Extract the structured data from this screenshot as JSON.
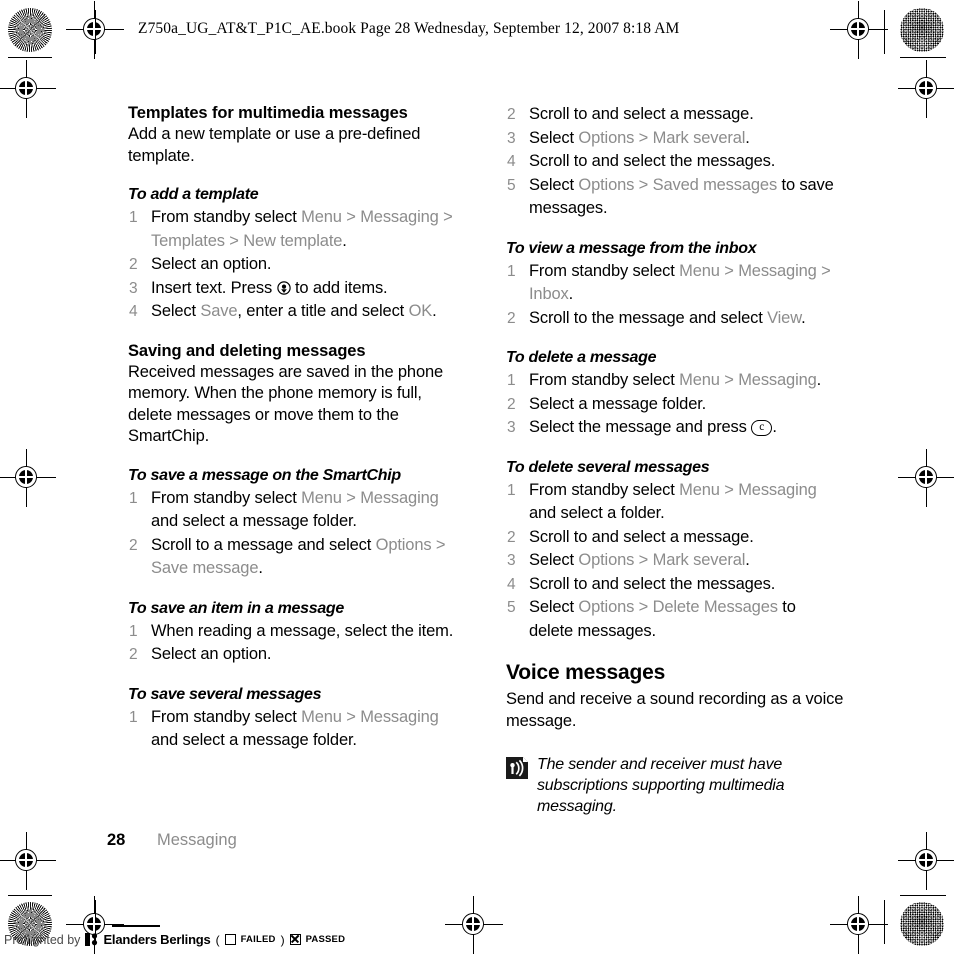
{
  "book_header": "Z750a_UG_AT&T_P1C_AE.book  Page 28  Wednesday, September 12, 2007  8:18 AM",
  "left_column": {
    "section_title": "Templates for multimedia messages",
    "section_intro": "Add a new template or use a pre-defined template.",
    "task1": {
      "title": "To add a template",
      "steps": [
        {
          "parts": [
            {
              "t": "From standby select ",
              "s": "plain"
            },
            {
              "t": "Menu",
              "s": "ui"
            },
            {
              "t": " > ",
              "s": "sep"
            },
            {
              "t": "Messaging",
              "s": "ui"
            },
            {
              "t": " > ",
              "s": "sep"
            },
            {
              "t": "Templates",
              "s": "ui"
            },
            {
              "t": " > ",
              "s": "sep"
            },
            {
              "t": "New template",
              "s": "ui"
            },
            {
              "t": ".",
              "s": "plain"
            }
          ]
        },
        {
          "parts": [
            {
              "t": "Select an option.",
              "s": "plain"
            }
          ]
        },
        {
          "parts": [
            {
              "t": "Insert text. Press ",
              "s": "plain"
            },
            {
              "t": "",
              "s": "navkey"
            },
            {
              "t": " to add items.",
              "s": "plain"
            }
          ]
        },
        {
          "parts": [
            {
              "t": "Select ",
              "s": "plain"
            },
            {
              "t": "Save",
              "s": "ui"
            },
            {
              "t": ", enter a title and select ",
              "s": "plain"
            },
            {
              "t": "OK",
              "s": "ui"
            },
            {
              "t": ".",
              "s": "plain"
            }
          ]
        }
      ]
    },
    "section2_title": "Saving and deleting messages",
    "section2_intro": "Received messages are saved in the phone memory. When the phone memory is full, delete messages or move them to the SmartChip.",
    "task2": {
      "title": "To save a message on the SmartChip",
      "steps": [
        {
          "parts": [
            {
              "t": "From standby select ",
              "s": "plain"
            },
            {
              "t": "Menu",
              "s": "ui"
            },
            {
              "t": " > ",
              "s": "sep"
            },
            {
              "t": "Messaging",
              "s": "ui"
            },
            {
              "t": " and select a message folder.",
              "s": "plain"
            }
          ]
        },
        {
          "parts": [
            {
              "t": "Scroll to a message and select ",
              "s": "plain"
            },
            {
              "t": "Options",
              "s": "ui"
            },
            {
              "t": " > ",
              "s": "sep"
            },
            {
              "t": "Save message",
              "s": "ui"
            },
            {
              "t": ".",
              "s": "plain"
            }
          ]
        }
      ]
    },
    "task3": {
      "title": "To save an item in a message",
      "steps": [
        {
          "parts": [
            {
              "t": "When reading a message, select the item.",
              "s": "plain"
            }
          ]
        },
        {
          "parts": [
            {
              "t": "Select an option.",
              "s": "plain"
            }
          ]
        }
      ]
    },
    "task4": {
      "title": "To save several messages",
      "steps": [
        {
          "parts": [
            {
              "t": "From standby select ",
              "s": "plain"
            },
            {
              "t": "Menu",
              "s": "ui"
            },
            {
              "t": " > ",
              "s": "sep"
            },
            {
              "t": "Messaging",
              "s": "ui"
            },
            {
              "t": " and select a message folder.",
              "s": "plain"
            }
          ]
        }
      ]
    }
  },
  "right_column": {
    "task4_cont": {
      "steps": [
        {
          "n": 2,
          "parts": [
            {
              "t": "Scroll to and select a message.",
              "s": "plain"
            }
          ]
        },
        {
          "n": 3,
          "parts": [
            {
              "t": "Select ",
              "s": "plain"
            },
            {
              "t": "Options",
              "s": "ui"
            },
            {
              "t": " > ",
              "s": "sep"
            },
            {
              "t": "Mark several",
              "s": "ui"
            },
            {
              "t": ".",
              "s": "plain"
            }
          ]
        },
        {
          "n": 4,
          "parts": [
            {
              "t": "Scroll to and select the messages.",
              "s": "plain"
            }
          ]
        },
        {
          "n": 5,
          "parts": [
            {
              "t": "Select ",
              "s": "plain"
            },
            {
              "t": "Options",
              "s": "ui"
            },
            {
              "t": " > ",
              "s": "sep"
            },
            {
              "t": "Saved messages",
              "s": "ui"
            },
            {
              "t": " to save messages.",
              "s": "plain"
            }
          ]
        }
      ]
    },
    "task5": {
      "title": "To view a message from the inbox",
      "steps": [
        {
          "n": 1,
          "parts": [
            {
              "t": "From standby select ",
              "s": "plain"
            },
            {
              "t": "Menu",
              "s": "ui"
            },
            {
              "t": " > ",
              "s": "sep"
            },
            {
              "t": "Messaging",
              "s": "ui"
            },
            {
              "t": " > ",
              "s": "sep"
            },
            {
              "t": "Inbox",
              "s": "ui"
            },
            {
              "t": ".",
              "s": "plain"
            }
          ]
        },
        {
          "n": 2,
          "parts": [
            {
              "t": "Scroll to the message and select ",
              "s": "plain"
            },
            {
              "t": "View",
              "s": "ui"
            },
            {
              "t": ".",
              "s": "plain"
            }
          ]
        }
      ]
    },
    "task6": {
      "title": "To delete a message",
      "steps": [
        {
          "n": 1,
          "parts": [
            {
              "t": "From standby select ",
              "s": "plain"
            },
            {
              "t": "Menu",
              "s": "ui"
            },
            {
              "t": " > ",
              "s": "sep"
            },
            {
              "t": "Messaging",
              "s": "ui"
            },
            {
              "t": ".",
              "s": "plain"
            }
          ]
        },
        {
          "n": 2,
          "parts": [
            {
              "t": "Select a message folder.",
              "s": "plain"
            }
          ]
        },
        {
          "n": 3,
          "parts": [
            {
              "t": "Select the message and press ",
              "s": "plain"
            },
            {
              "t": "c",
              "s": "keycap"
            },
            {
              "t": ".",
              "s": "plain"
            }
          ]
        }
      ]
    },
    "task7": {
      "title": "To delete several messages",
      "steps": [
        {
          "n": 1,
          "parts": [
            {
              "t": "From standby select ",
              "s": "plain"
            },
            {
              "t": "Menu",
              "s": "ui"
            },
            {
              "t": " > ",
              "s": "sep"
            },
            {
              "t": "Messaging",
              "s": "ui"
            },
            {
              "t": " and select a folder.",
              "s": "plain"
            }
          ]
        },
        {
          "n": 2,
          "parts": [
            {
              "t": "Scroll to and select a message.",
              "s": "plain"
            }
          ]
        },
        {
          "n": 3,
          "parts": [
            {
              "t": "Select ",
              "s": "plain"
            },
            {
              "t": "Options",
              "s": "ui"
            },
            {
              "t": " > ",
              "s": "sep"
            },
            {
              "t": "Mark several",
              "s": "ui"
            },
            {
              "t": ".",
              "s": "plain"
            }
          ]
        },
        {
          "n": 4,
          "parts": [
            {
              "t": "Scroll to and select the messages.",
              "s": "plain"
            }
          ]
        },
        {
          "n": 5,
          "parts": [
            {
              "t": "Select ",
              "s": "plain"
            },
            {
              "t": "Options",
              "s": "ui"
            },
            {
              "t": " > ",
              "s": "sep"
            },
            {
              "t": "Delete Messages",
              "s": "ui"
            },
            {
              "t": " to delete messages.",
              "s": "plain"
            }
          ]
        }
      ]
    },
    "chapter_title": "Voice messages",
    "chapter_intro": "Send and receive a sound recording as a voice message.",
    "note": {
      "icon": "note-broadcast-icon",
      "text": "The sender and receiver must have subscriptions supporting multimedia messaging."
    }
  },
  "footer": {
    "page_number": "28",
    "section_name": "Messaging"
  },
  "preflight": {
    "by_label": "Preflighted by",
    "brand": "Elanders Berlings",
    "open_paren": "(",
    "failed_label": "FAILED",
    "close_paren": ")",
    "passed_label": "PASSED"
  },
  "colors": {
    "ui_reference_gray": "#8c8c8c",
    "body_black": "#000000",
    "footer_gray": "#8c8c8c"
  }
}
